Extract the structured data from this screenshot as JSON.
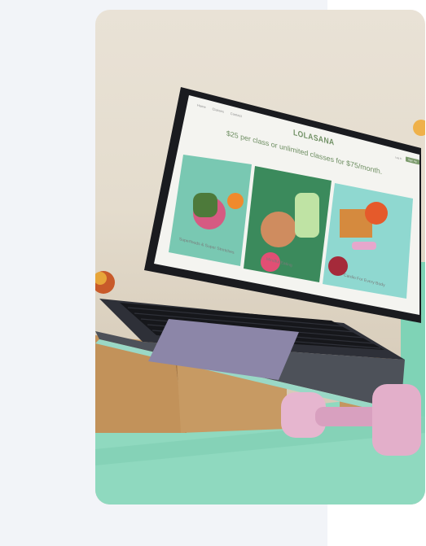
{
  "site": {
    "brand": "LOLASANA",
    "nav": [
      "Home",
      "Classes",
      "Contact"
    ],
    "login": "Log In",
    "signup": "Sign Up",
    "tagline": "$25 per class or unlimited classes for $75/month.",
    "products": [
      {
        "label": "Superfoods & Super Stretches"
      },
      {
        "label": "Mindful Eating"
      },
      {
        "label": "Cardio For Every Body"
      }
    ]
  },
  "colors": {
    "page_left": "#f2f4f8",
    "brand_green": "#6f8f63",
    "mat": "#8fd9bf",
    "cork": "#c2925a",
    "dumbbell": "#e6b6cf"
  },
  "icons": [
    "laptop",
    "keyboard",
    "trackpad",
    "dumbbell",
    "cork-block",
    "yoga-mat"
  ]
}
